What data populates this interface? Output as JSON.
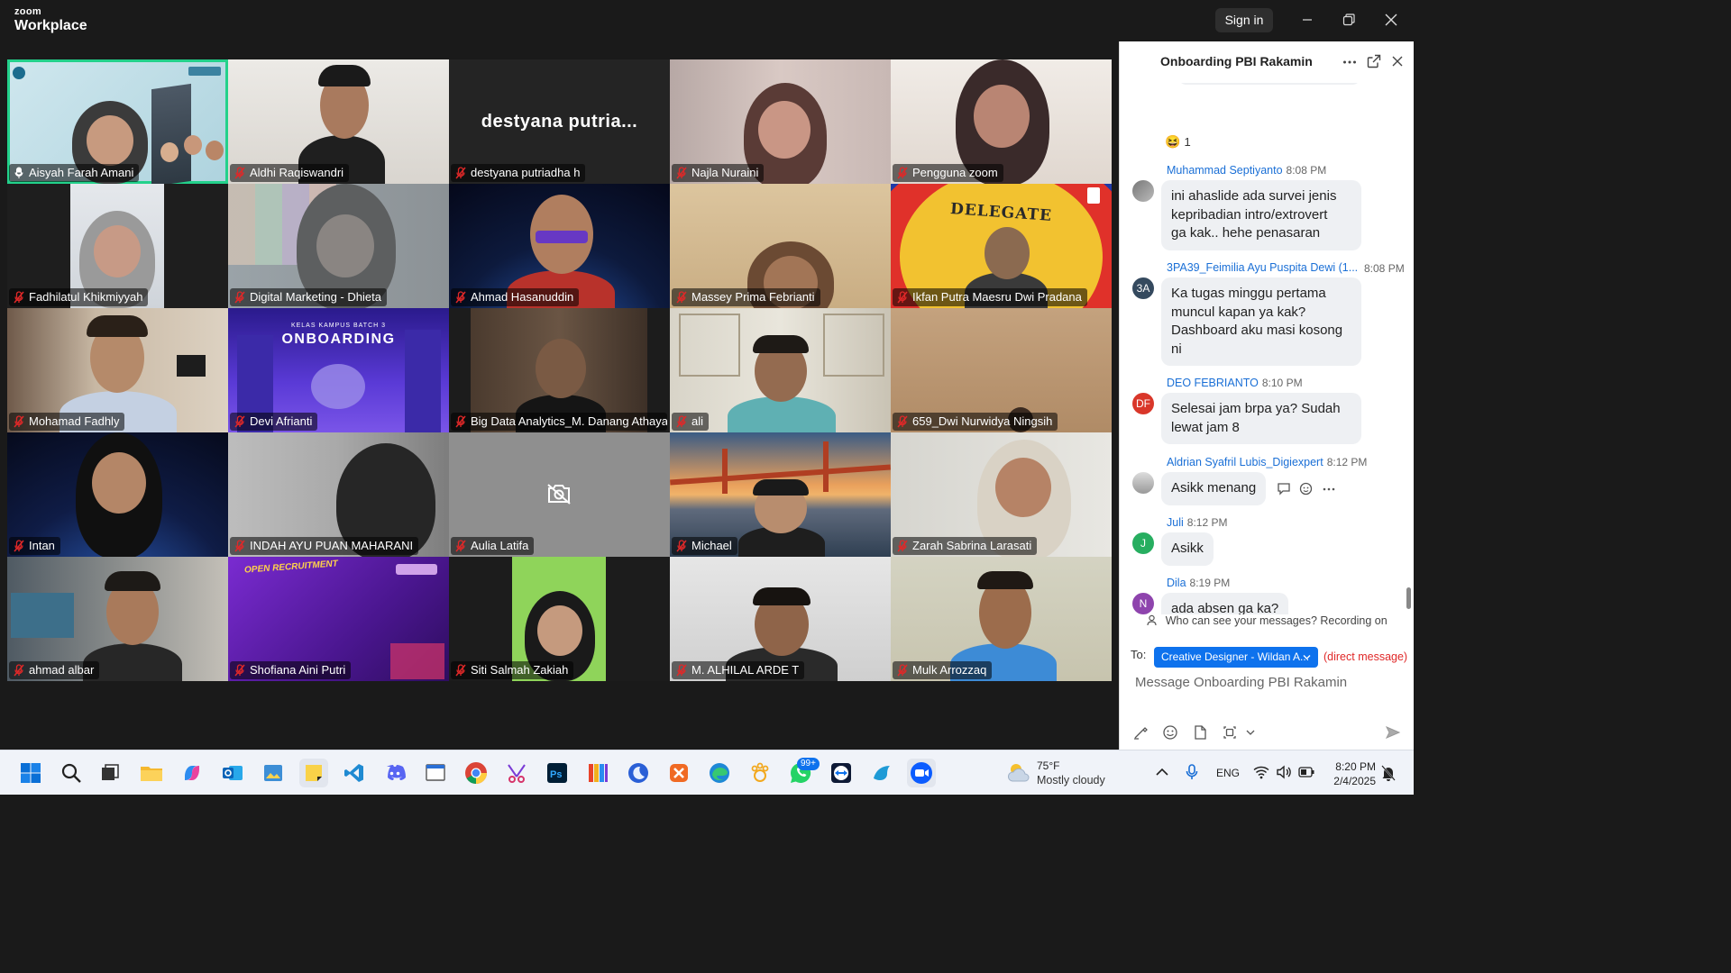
{
  "app": {
    "brand_top": "zoom",
    "brand_name": "Workplace",
    "sign_in": "Sign in"
  },
  "meeting": {
    "participants": [
      {
        "name": "Aisyah Farah Amani"
      },
      {
        "name": "Aldhi Raqiswandri"
      },
      {
        "name": "destyana putriadha h",
        "display_name": "destyana  putria..."
      },
      {
        "name": "Najla Nuraini"
      },
      {
        "name": "Pengguna zoom"
      },
      {
        "name": "Fadhilatul Khikmiyyah"
      },
      {
        "name": "Digital Marketing - Dhieta"
      },
      {
        "name": "Ahmad Hasanuddin"
      },
      {
        "name": "Massey Prima Febrianti"
      },
      {
        "name": "Ikfan Putra Maesru Dwi Pradana",
        "background_text": "DELEGATE"
      },
      {
        "name": "Mohamad Fadhly"
      },
      {
        "name": "Devi Afrianti",
        "background_text": "ONBOARDING",
        "background_subtext": "KELAS KAMPUS BATCH 3"
      },
      {
        "name": "Big Data Analytics_M. Danang Athaya"
      },
      {
        "name": "ali"
      },
      {
        "name": "659_Dwi Nurwidya Ningsih"
      },
      {
        "name": "Intan"
      },
      {
        "name": "INDAH AYU PUAN MAHARANI"
      },
      {
        "name": "Aulia Latifa"
      },
      {
        "name": "Michael"
      },
      {
        "name": "Zarah Sabrina Larasati"
      },
      {
        "name": "ahmad albar"
      },
      {
        "name": "Shofiana Aini Putri",
        "background_text": "OPEN RECRUITMENT"
      },
      {
        "name": "Siti Salmah Zakiah"
      },
      {
        "name": "M. ALHILAL ARDE T"
      },
      {
        "name": "Mulk Arrozzaq"
      }
    ]
  },
  "chat": {
    "title": "Onboarding PBI Rakamin",
    "reaction": {
      "emoji": "😆",
      "count": "1"
    },
    "messages": [
      {
        "sender": "Muhammad Septiyanto",
        "time": "8:08 PM",
        "lines": [
          "ini ahaslide ada survei jenis",
          "kepribadian intro/extrovert",
          "ga kak.. hehe penasaran"
        ]
      },
      {
        "sender": "3PA39_Feimilia Ayu Puspita Dewi (1...",
        "time": "8:08 PM",
        "initials": "3A",
        "lines": [
          "Ka tugas minggu pertama",
          "muncul kapan ya kak?",
          "Dashboard aku masi kosong",
          "ni"
        ]
      },
      {
        "sender": "DEO FEBRIANTO",
        "time": "8:10 PM",
        "initials": "DF",
        "lines": [
          "Selesai jam brpa ya? Sudah",
          "lewat jam 8"
        ]
      },
      {
        "sender": "Aldrian Syafril Lubis_Digiexpert",
        "time": "8:12 PM",
        "lines": [
          "Asikk menang"
        ]
      },
      {
        "sender": "Juli",
        "time": "8:12 PM",
        "initials": "J",
        "lines": [
          "Asikk"
        ]
      },
      {
        "sender": "Dila",
        "time": "8:19 PM",
        "initials": "N",
        "lines": [
          "ada absen ga ka?"
        ]
      }
    ],
    "privacy_notice": "Who can see your messages? Recording on",
    "to_label": "To:",
    "recipient": "Creative Designer - Wildan A...",
    "direct_label": "(direct message)",
    "input_placeholder": "Message Onboarding PBI Rakamin"
  },
  "taskbar": {
    "weather": {
      "temp": "75°F",
      "desc": "Mostly cloudy"
    },
    "badge": "99+",
    "lang": "ENG",
    "time": "8:20 PM",
    "date": "2/4/2025"
  }
}
